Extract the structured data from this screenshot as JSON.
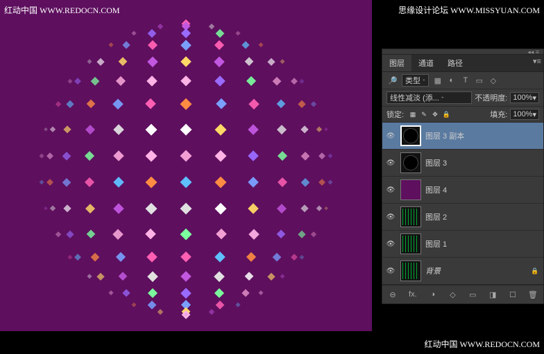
{
  "watermarks": {
    "tl": "红动中国 WWW.REDOCN.COM",
    "tr": "思缘设计论坛 WWW.MISSYUAN.COM",
    "br": "红动中国 WWW.REDOCN.COM"
  },
  "tabs": {
    "layers": "图层",
    "channels": "通道",
    "paths": "路径"
  },
  "filter": {
    "label": "类型",
    "icons": [
      "▦",
      "◐",
      "T",
      "▭",
      "◇"
    ]
  },
  "blend": {
    "mode": "线性减淡 (添...",
    "opacityLabel": "不透明度:",
    "opacityValue": "100%"
  },
  "lock": {
    "label": "锁定:",
    "fillLabel": "填充:",
    "fillValue": "100%"
  },
  "layers_list": [
    {
      "name": "图层 3 副本",
      "selected": true,
      "thumb": "circle"
    },
    {
      "name": "图层 3",
      "thumb": "circle"
    },
    {
      "name": "图层 4",
      "thumb": "purple"
    },
    {
      "name": "图层 2",
      "thumb": "grid"
    },
    {
      "name": "图层 1",
      "thumb": "grid2"
    },
    {
      "name": "背景",
      "thumb": "grid2",
      "locked": true,
      "italic": true
    }
  ],
  "bottom_icons": [
    "⊖",
    "fx.",
    "◑",
    "◇",
    "▭",
    "◨",
    "☐",
    "🗑"
  ],
  "sphere": {
    "palette": [
      "#ff5fb3",
      "#ffffff",
      "#9a6bff",
      "#5fbfff",
      "#ffd866",
      "#7cff9e",
      "#ff8c42",
      "#c257e0",
      "#f2a0d4",
      "#7aa0ff",
      "#e0e0e0",
      "#ffb3e6"
    ],
    "rows": 18,
    "colsEquator": 26
  }
}
